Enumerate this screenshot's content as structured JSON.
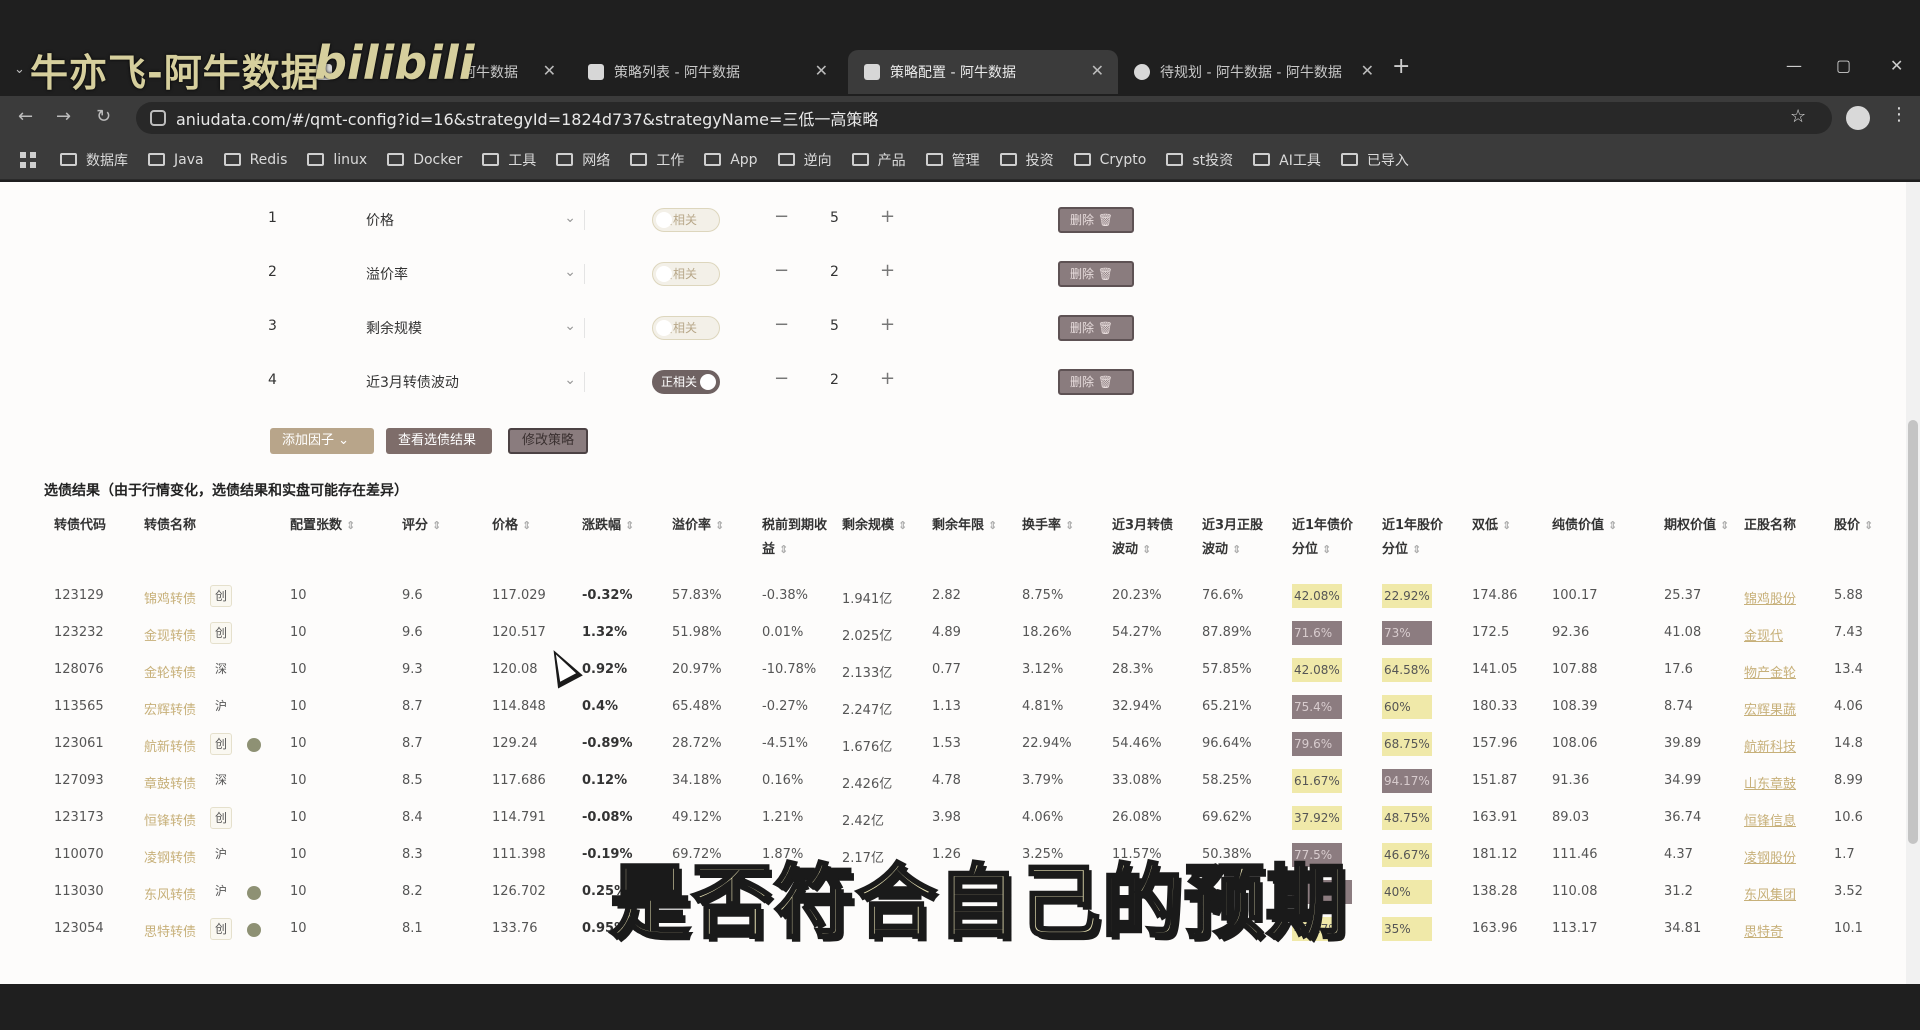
{
  "watermark": {
    "text": "牛亦飞-阿牛数据",
    "logo": "bilibili"
  },
  "tabs": [
    {
      "title": "牛亦飞-阿牛数据",
      "active": false
    },
    {
      "title": "阿牛数据",
      "active": false
    },
    {
      "title": "策略列表 - 阿牛数据",
      "active": false
    },
    {
      "title": "策略配置 - 阿牛数据",
      "active": true
    },
    {
      "title": "待规划 - 阿牛数据 - 阿牛数据",
      "active": false
    }
  ],
  "window_controls": {
    "minimize": "—",
    "maximize": "▢",
    "close": "✕"
  },
  "url": "aniudata.com/#/qmt-config?id=16&strategyId=1824d737&strategyName=三低一高策略",
  "bookmarks": [
    "数据库",
    "Java",
    "Redis",
    "linux",
    "Docker",
    "工具",
    "网络",
    "工作",
    "App",
    "逆向",
    "产品",
    "管理",
    "投资",
    "Crypto",
    "st投资",
    "AI工具",
    "已导入"
  ],
  "factors": [
    {
      "idx": "1",
      "name": "价格",
      "toggle": "负相关",
      "toggle_on": false,
      "value": "5",
      "delete": "删除"
    },
    {
      "idx": "2",
      "name": "溢价率",
      "toggle": "负相关",
      "toggle_on": false,
      "value": "2",
      "delete": "删除"
    },
    {
      "idx": "3",
      "name": "剩余规模",
      "toggle": "负相关",
      "toggle_on": false,
      "value": "5",
      "delete": "删除"
    },
    {
      "idx": "4",
      "name": "近3月转债波动",
      "toggle": "正相关",
      "toggle_on": true,
      "value": "2",
      "delete": "删除"
    }
  ],
  "actions": {
    "add_factor": "添加因子",
    "view_result": "查看选债结果",
    "edit_strategy": "修改策略"
  },
  "result_title": "选债结果（由于行情变化，选债结果和实盘可能存在差异）",
  "table": {
    "headers": [
      "转债代码",
      "转债名称",
      "配置张数",
      "评分",
      "价格",
      "涨跌幅",
      "溢价率",
      "税前到期收益",
      "剩余规模",
      "剩余年限",
      "换手率",
      "近3月转债波动",
      "近3月正股波动",
      "近1年债价分位",
      "近1年股价分位",
      "双低",
      "纯债价值",
      "期权价值",
      "正股名称",
      "股价"
    ],
    "rows": [
      {
        "code": "123129",
        "name": "锦鸡转债",
        "tag": "创",
        "check": false,
        "qty": "10",
        "score": "9.6",
        "price": "117.029",
        "chg": "-0.32%",
        "premium": "57.83%",
        "ytm": "-0.38%",
        "size": "1.941亿",
        "years": "2.82",
        "turnover": "8.75%",
        "vol_cb": "20.23%",
        "vol_stock": "76.6%",
        "bond_pct": "42.08%",
        "bond_pct_style": "y",
        "stock_pct": "22.92%",
        "stock_pct_style": "y",
        "dual_low": "174.86",
        "bond_value": "100.17",
        "option_value": "25.37",
        "stock_name": "锦鸡股份",
        "stock_price": "5.88"
      },
      {
        "code": "123232",
        "name": "金现转债",
        "tag": "创",
        "check": false,
        "qty": "10",
        "score": "9.6",
        "price": "120.517",
        "chg": "1.32%",
        "premium": "51.98%",
        "ytm": "0.01%",
        "size": "2.025亿",
        "years": "4.89",
        "turnover": "18.26%",
        "vol_cb": "54.27%",
        "vol_stock": "87.89%",
        "bond_pct": "71.6%",
        "bond_pct_style": "m",
        "stock_pct": "73%",
        "stock_pct_style": "m",
        "dual_low": "172.5",
        "bond_value": "92.36",
        "option_value": "41.08",
        "stock_name": "金现代",
        "stock_price": "7.43"
      },
      {
        "code": "128076",
        "name": "金轮转债",
        "tag": "深",
        "check": false,
        "qty": "10",
        "score": "9.3",
        "price": "120.08",
        "chg": "0.92%",
        "premium": "20.97%",
        "ytm": "-10.78%",
        "size": "2.133亿",
        "years": "0.77",
        "turnover": "3.12%",
        "vol_cb": "28.3%",
        "vol_stock": "57.85%",
        "bond_pct": "42.08%",
        "bond_pct_style": "y",
        "stock_pct": "64.58%",
        "stock_pct_style": "y",
        "dual_low": "141.05",
        "bond_value": "107.88",
        "option_value": "17.6",
        "stock_name": "物产金轮",
        "stock_price": "13.4"
      },
      {
        "code": "113565",
        "name": "宏辉转债",
        "tag": "沪",
        "check": false,
        "qty": "10",
        "score": "8.7",
        "price": "114.848",
        "chg": "0.4%",
        "premium": "65.48%",
        "ytm": "-0.27%",
        "size": "2.247亿",
        "years": "1.13",
        "turnover": "4.81%",
        "vol_cb": "32.94%",
        "vol_stock": "65.21%",
        "bond_pct": "75.4%",
        "bond_pct_style": "m",
        "stock_pct": "60%",
        "stock_pct_style": "y",
        "dual_low": "180.33",
        "bond_value": "108.39",
        "option_value": "8.74",
        "stock_name": "宏辉果蔬",
        "stock_price": "4.06"
      },
      {
        "code": "123061",
        "name": "航新转债",
        "tag": "创",
        "check": true,
        "qty": "10",
        "score": "8.7",
        "price": "129.24",
        "chg": "-0.89%",
        "premium": "28.72%",
        "ytm": "-4.51%",
        "size": "1.676亿",
        "years": "1.53",
        "turnover": "22.94%",
        "vol_cb": "54.46%",
        "vol_stock": "96.64%",
        "bond_pct": "79.6%",
        "bond_pct_style": "m",
        "stock_pct": "68.75%",
        "stock_pct_style": "y",
        "dual_low": "157.96",
        "bond_value": "108.06",
        "option_value": "39.89",
        "stock_name": "航新科技",
        "stock_price": "14.8"
      },
      {
        "code": "127093",
        "name": "章鼓转债",
        "tag": "深",
        "check": false,
        "qty": "10",
        "score": "8.5",
        "price": "117.686",
        "chg": "0.12%",
        "premium": "34.18%",
        "ytm": "0.16%",
        "size": "2.426亿",
        "years": "4.78",
        "turnover": "3.79%",
        "vol_cb": "33.08%",
        "vol_stock": "58.25%",
        "bond_pct": "61.67%",
        "bond_pct_style": "y",
        "stock_pct": "94.17%",
        "stock_pct_style": "m",
        "dual_low": "151.87",
        "bond_value": "91.36",
        "option_value": "34.99",
        "stock_name": "山东章鼓",
        "stock_price": "8.99"
      },
      {
        "code": "123173",
        "name": "恒锋转债",
        "tag": "创",
        "check": false,
        "qty": "10",
        "score": "8.4",
        "price": "114.791",
        "chg": "-0.08%",
        "premium": "49.12%",
        "ytm": "1.21%",
        "size": "2.42亿",
        "years": "3.98",
        "turnover": "4.06%",
        "vol_cb": "26.08%",
        "vol_stock": "69.62%",
        "bond_pct": "37.92%",
        "bond_pct_style": "y",
        "stock_pct": "48.75%",
        "stock_pct_style": "y",
        "dual_low": "163.91",
        "bond_value": "89.03",
        "option_value": "36.74",
        "stock_name": "恒锋信息",
        "stock_price": "10.6"
      },
      {
        "code": "110070",
        "name": "凌钢转债",
        "tag": "沪",
        "check": false,
        "qty": "10",
        "score": "8.3",
        "price": "111.398",
        "chg": "-0.19%",
        "premium": "69.72%",
        "ytm": "1.87%",
        "size": "2.17亿",
        "years": "1.26",
        "turnover": "3.25%",
        "vol_cb": "11.57%",
        "vol_stock": "50.38%",
        "bond_pct": "77.5%",
        "bond_pct_style": "m",
        "stock_pct": "46.67%",
        "stock_pct_style": "y",
        "dual_low": "181.12",
        "bond_value": "111.46",
        "option_value": "4.37",
        "stock_name": "凌钢股份",
        "stock_price": "1.7"
      },
      {
        "code": "113030",
        "name": "东风转债",
        "tag": "沪",
        "check": true,
        "qty": "10",
        "score": "8.2",
        "price": "126.702",
        "chg": "0.25%",
        "premium": "",
        "ytm": "",
        "size": "",
        "years": "",
        "turnover": "",
        "vol_cb": "",
        "vol_stock": "",
        "bond_pct": "",
        "bond_pct_style": "m",
        "stock_pct": "40%",
        "stock_pct_style": "y",
        "dual_low": "138.28",
        "bond_value": "110.08",
        "option_value": "31.2",
        "stock_name": "东风集团",
        "stock_price": "3.52"
      },
      {
        "code": "123054",
        "name": "思特转债",
        "tag": "创",
        "check": true,
        "qty": "10",
        "score": "8.1",
        "price": "133.76",
        "chg": "0.95%",
        "premium": "",
        "ytm": "",
        "size": "",
        "years": "",
        "turnover": "",
        "vol_cb": "",
        "vol_stock": "",
        "bond_pct": "47.17%",
        "bond_pct_style": "y",
        "stock_pct": "35%",
        "stock_pct_style": "y",
        "dual_low": "163.96",
        "bond_value": "113.17",
        "option_value": "34.81",
        "stock_name": "思特奇",
        "stock_price": "10.1"
      }
    ]
  },
  "subtitle": "是否符合自己的预期",
  "colors": {
    "chip_yellow": "#f0e9a9",
    "chip_mauve": "#8c7c80",
    "link": "#c7b079",
    "button_dark": "#7e6d6a"
  }
}
